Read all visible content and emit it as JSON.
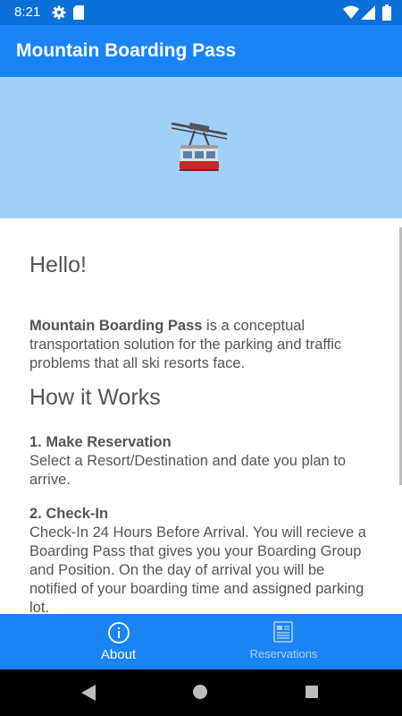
{
  "status_bar": {
    "time": "8:21",
    "icons": [
      "gear-icon",
      "sd-card-icon",
      "wifi-icon",
      "signal-icon",
      "battery-icon"
    ]
  },
  "app_bar": {
    "title": "Mountain Boarding Pass"
  },
  "hero": {
    "image": "gondola-cable-car-icon",
    "background": "#9fd0f8"
  },
  "content": {
    "greeting": "Hello!",
    "intro_bold": "Mountain Boarding Pass",
    "intro_text": " is a conceptual transportation solution for the parking and traffic problems that all ski resorts face.",
    "how_heading": "How it Works",
    "steps": [
      {
        "title": "1. Make Reservation",
        "text": "Select a Resort/Destination and date you plan to arrive."
      },
      {
        "title": "2. Check-In",
        "text": "Check-In 24 Hours Before Arrival.  You will recieve a Boarding Pass that gives you your Boarding Group and Position. On the day of arrival you will be notified of your boarding time and assigned parking lot."
      }
    ]
  },
  "bottom_nav": {
    "items": [
      {
        "label": "About",
        "icon": "info-icon",
        "active": true
      },
      {
        "label": "Reservations",
        "icon": "reservations-icon",
        "active": false
      }
    ]
  },
  "colors": {
    "primary": "#1a84f4",
    "status_bar": "#0a6fd6",
    "text": "#555555"
  }
}
